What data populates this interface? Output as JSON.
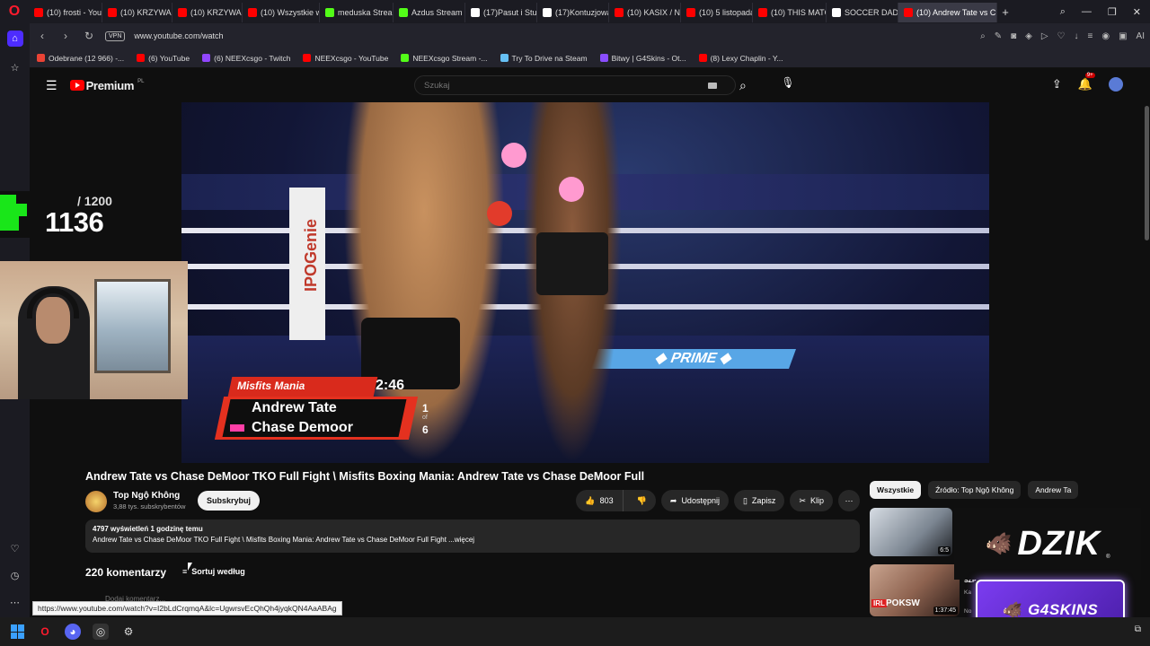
{
  "browser": {
    "tabs": [
      {
        "label": "(10) frosti - YouT",
        "color": "#ff0000"
      },
      {
        "label": "(10) KRZYWA AK",
        "color": "#ff0000"
      },
      {
        "label": "(10) KRZYWA AK",
        "color": "#ff0000"
      },
      {
        "label": "(10) Wszystkie w",
        "color": "#ff0000"
      },
      {
        "label": "meduska Stream",
        "color": "#53fc18"
      },
      {
        "label": "Azdus Stream -",
        "color": "#53fc18"
      },
      {
        "label": "(17)Pasut i Stul",
        "color": "#ffffff"
      },
      {
        "label": "(17)Kontuzjowan",
        "color": "#ffffff"
      },
      {
        "label": "(10) KASIX / NIT",
        "color": "#ff0000"
      },
      {
        "label": "(10) 5 listopada",
        "color": "#ff0000"
      },
      {
        "label": "(10) THIS MATC",
        "color": "#ff0000"
      },
      {
        "label": "SOCCER DADDY",
        "color": "#ffffff"
      },
      {
        "label": "(10) Andrew Tate vs C",
        "color": "#ff0000",
        "active": true
      }
    ],
    "new_tab": "+",
    "vpn_label": "VPN",
    "url": "www.youtube.com/watch",
    "bookmarks": [
      {
        "label": "Odebrane (12 966) -...",
        "color": "#ea4335"
      },
      {
        "label": "(6) YouTube",
        "color": "#ff0000"
      },
      {
        "label": "(6) NEEXcsgo - Twitch",
        "color": "#9146ff"
      },
      {
        "label": "NEEXcsgo - YouTube",
        "color": "#ff0000"
      },
      {
        "label": "NEEXcsgo Stream -...",
        "color": "#53fc18"
      },
      {
        "label": "Try To Drive na Steam",
        "color": "#66c0f4"
      },
      {
        "label": "Bitwy | G4Skins - Ot...",
        "color": "#8a4dff"
      },
      {
        "label": "(8) Lexy Chaplin - Y...",
        "color": "#ff0000"
      }
    ],
    "ai_label": "AI"
  },
  "youtube": {
    "logo_text": "Premium",
    "logo_region": "PL",
    "search_placeholder": "Szukaj",
    "notif_count": "9+"
  },
  "stream_overlay": {
    "counter_total": "/ 1200",
    "counter_value": "1136"
  },
  "video": {
    "scorebug": {
      "show": "Misfits Mania",
      "time": "2:46",
      "fighter1": "Andrew Tate",
      "fighter2": "Chase Demoor",
      "round": "1",
      "of": "of",
      "total_rounds": "6"
    },
    "title": "Andrew Tate vs Chase DeMoor TKO Full Fight \\ Misfits Boxing Mania: Andrew Tate vs Chase DeMoor Full",
    "channel": {
      "name": "Top Ngộ Không",
      "subs": "3,88 tys. subskrybentów",
      "subscribe_label": "Subskrybuj"
    },
    "actions": {
      "likes": "803",
      "share": "Udostępnij",
      "save": "Zapisz",
      "clip": "Klip"
    },
    "description": {
      "meta": "4797 wyświetleń  1 godzinę temu",
      "text": "Andrew Tate vs Chase DeMoor TKO Full Fight \\ Misfits Boxing Mania: Andrew Tate vs Chase DeMoor Full Fight ...więcej"
    },
    "comments": {
      "count": "220 komentarzy",
      "sort_label": "Sortuj według",
      "add_placeholder": "Dodaj komentarz..."
    }
  },
  "related": {
    "chips": [
      "Wszystkie",
      "Źródło: Top Ngộ Không",
      "Andrew Ta"
    ],
    "items": [
      {
        "title": "SZP",
        "duration": "6:5",
        "meta1": "Ka",
        "meta2": "No"
      },
      {
        "live_tag": "IRL",
        "label": "POKSW",
        "duration": "1:37:45"
      }
    ]
  },
  "sponsors": {
    "dzik": "DZIK",
    "dzik_reg": "®",
    "g4skins": "G4SKINS"
  },
  "status_bar_url": "https://www.youtube.com/watch?v=I2bLdCrqmqA&lc=UgwrsvEcQhQh4jyqkQN4AaABAg"
}
